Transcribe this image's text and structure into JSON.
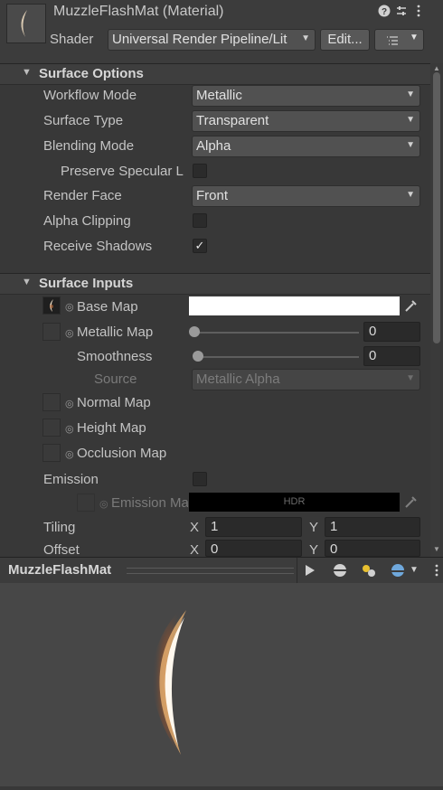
{
  "header": {
    "title": "MuzzleFlashMat (Material)",
    "shader_label": "Shader",
    "shader_value": "Universal Render Pipeline/Lit",
    "edit_button": "Edit...",
    "icons": [
      "help-icon",
      "preset-icon",
      "more-icon",
      "list-icon"
    ]
  },
  "surface_options": {
    "title": "Surface Options",
    "rows": [
      {
        "label": "Workflow Mode",
        "value": "Metallic"
      },
      {
        "label": "Surface Type",
        "value": "Transparent"
      },
      {
        "label": "Blending Mode",
        "value": "Alpha"
      }
    ],
    "preserve_specular_label": "Preserve Specular L",
    "preserve_specular_checked": false,
    "render_face_label": "Render Face",
    "render_face_value": "Front",
    "alpha_clipping_label": "Alpha Clipping",
    "alpha_clipping_checked": false,
    "receive_shadows_label": "Receive Shadows",
    "receive_shadows_checked": true,
    "check_glyph": "✓"
  },
  "surface_inputs": {
    "title": "Surface Inputs",
    "base_map_label": "Base Map",
    "metallic_map_label": "Metallic Map",
    "metallic_value": "0",
    "smoothness_label": "Smoothness",
    "smoothness_value": "0",
    "source_label": "Source",
    "source_value": "Metallic Alpha",
    "normal_map_label": "Normal Map",
    "height_map_label": "Height Map",
    "occlusion_map_label": "Occlusion Map",
    "emission_label": "Emission",
    "emission_checked": false,
    "emission_map_label": "Emission Ma",
    "hdr_label": "HDR",
    "tiling_label": "Tiling",
    "tiling_x": "1",
    "tiling_y": "1",
    "offset_label": "Offset",
    "offset_x": "0",
    "offset_y": "0",
    "x_axis": "X",
    "y_axis": "Y"
  },
  "preview": {
    "title": "MuzzleFlashMat",
    "icons": [
      "play-icon",
      "sphere-icon",
      "lights-icon",
      "skybox-icon",
      "more-icon"
    ]
  }
}
